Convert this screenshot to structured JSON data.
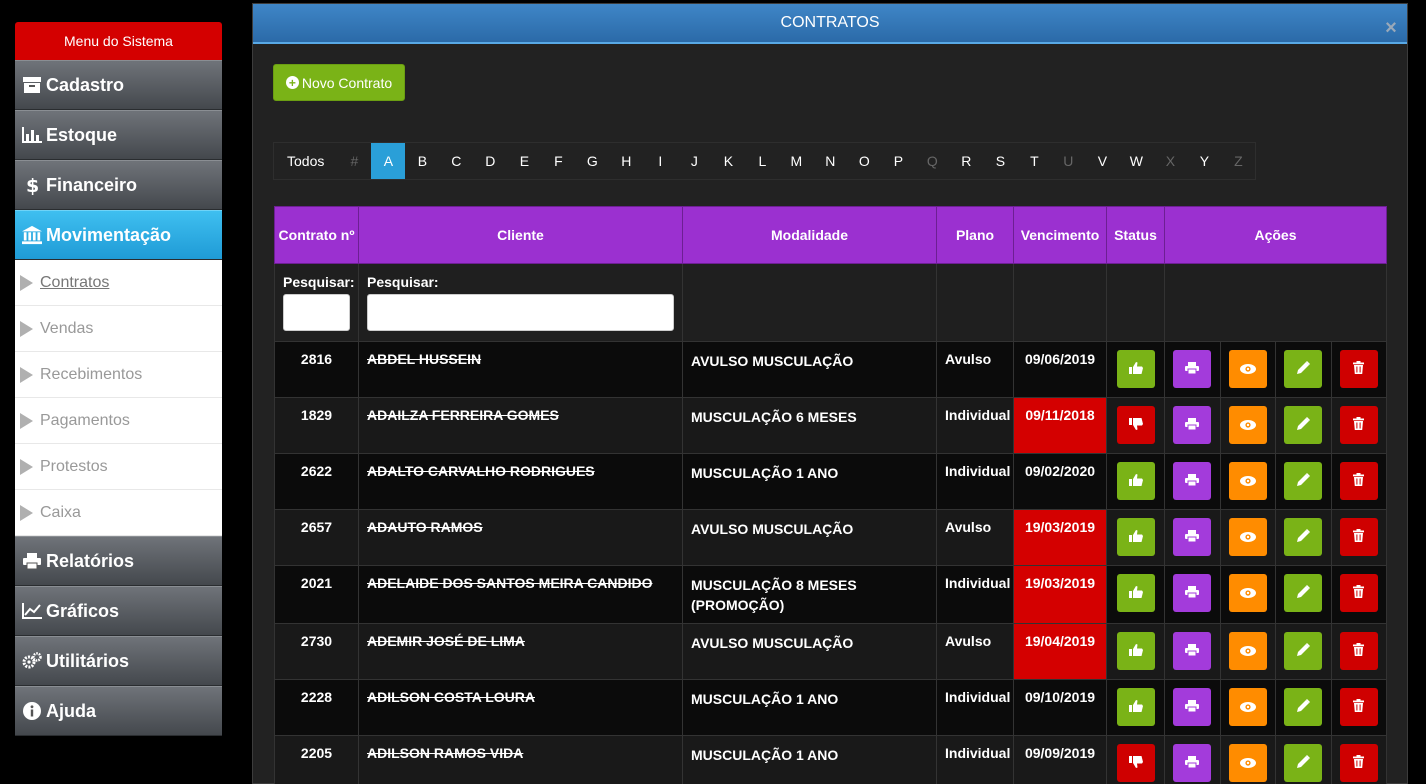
{
  "sidebar": {
    "title": "Menu do Sistema",
    "items": [
      {
        "label": "Cadastro",
        "icon": "archive-icon",
        "active": false
      },
      {
        "label": "Estoque",
        "icon": "bar-chart-icon",
        "active": false
      },
      {
        "label": "Financeiro",
        "icon": "dollar-icon",
        "active": false
      },
      {
        "label": "Movimentação",
        "icon": "bank-icon",
        "active": true
      }
    ],
    "submenu": [
      {
        "label": "Contratos",
        "current": true
      },
      {
        "label": "Vendas"
      },
      {
        "label": "Recebimentos"
      },
      {
        "label": "Pagamentos"
      },
      {
        "label": "Protestos"
      },
      {
        "label": "Caixa"
      }
    ],
    "items_after": [
      {
        "label": "Relatórios",
        "icon": "print-icon"
      },
      {
        "label": "Gráficos",
        "icon": "line-chart-icon"
      },
      {
        "label": "Utilitários",
        "icon": "gears-icon"
      },
      {
        "label": "Ajuda",
        "icon": "info-icon"
      }
    ]
  },
  "modal": {
    "title": "CONTRATOS",
    "close": "×",
    "new_button": "Novo Contrato",
    "alphabet": {
      "todos": "Todos",
      "letters": [
        "#",
        "A",
        "B",
        "C",
        "D",
        "E",
        "F",
        "G",
        "H",
        "I",
        "J",
        "K",
        "L",
        "M",
        "N",
        "O",
        "P",
        "Q",
        "R",
        "S",
        "T",
        "U",
        "V",
        "W",
        "X",
        "Y",
        "Z"
      ],
      "disabled": [
        "#",
        "Q",
        "U",
        "X",
        "Z"
      ],
      "selected": "A"
    },
    "table": {
      "headers": {
        "contrato": "Contrato nº",
        "cliente": "Cliente",
        "modalidade": "Modalidade",
        "plano": "Plano",
        "vencimento": "Vencimento",
        "status": "Status",
        "acoes": "Ações"
      },
      "search_label": "Pesquisar:",
      "rows": [
        {
          "num": "2816",
          "cliente": "ABDEL HUSSEIN",
          "modalidade": "AVULSO MUSCULAÇÃO",
          "plano": "Avulso",
          "vencimento": "09/06/2019",
          "expired": false,
          "status": "ok"
        },
        {
          "num": "1829",
          "cliente": "ADAILZA FERREIRA GOMES",
          "modalidade": "MUSCULAÇÃO 6 MESES",
          "plano": "Individual",
          "vencimento": "09/11/2018",
          "expired": true,
          "status": "bad"
        },
        {
          "num": "2622",
          "cliente": "ADALTO CARVALHO RODRIGUES",
          "modalidade": "MUSCULAÇÃO 1 ANO",
          "plano": "Individual",
          "vencimento": "09/02/2020",
          "expired": false,
          "status": "ok"
        },
        {
          "num": "2657",
          "cliente": "ADAUTO RAMOS",
          "modalidade": "AVULSO MUSCULAÇÃO",
          "plano": "Avulso",
          "vencimento": "19/03/2019",
          "expired": true,
          "status": "ok"
        },
        {
          "num": "2021",
          "cliente": "ADELAIDE DOS SANTOS MEIRA CANDIDO",
          "modalidade": "MUSCULAÇÃO 8 MESES (PROMOÇÃO)",
          "plano": "Individual",
          "vencimento": "19/03/2019",
          "expired": true,
          "status": "ok"
        },
        {
          "num": "2730",
          "cliente": "ADEMIR JOSÉ DE LIMA",
          "modalidade": "AVULSO MUSCULAÇÃO",
          "plano": "Avulso",
          "vencimento": "19/04/2019",
          "expired": true,
          "status": "ok"
        },
        {
          "num": "2228",
          "cliente": "ADILSON COSTA LOURA",
          "modalidade": "MUSCULAÇÃO 1 ANO",
          "plano": "Individual",
          "vencimento": "09/10/2019",
          "expired": false,
          "status": "ok"
        },
        {
          "num": "2205",
          "cliente": "ADILSON RAMOS VIDA",
          "modalidade": "MUSCULAÇÃO 1 ANO",
          "plano": "Individual",
          "vencimento": "09/09/2019",
          "expired": false,
          "status": "bad"
        }
      ]
    }
  },
  "colors": {
    "menu_title": "#d40000",
    "active_menu": "#2fb1e6",
    "header_purple": "#9b30d0",
    "green": "#7ab317",
    "red": "#cf0000",
    "purple": "#a33bdb",
    "orange": "#ff8c00",
    "modal_header": "#3577b8"
  }
}
